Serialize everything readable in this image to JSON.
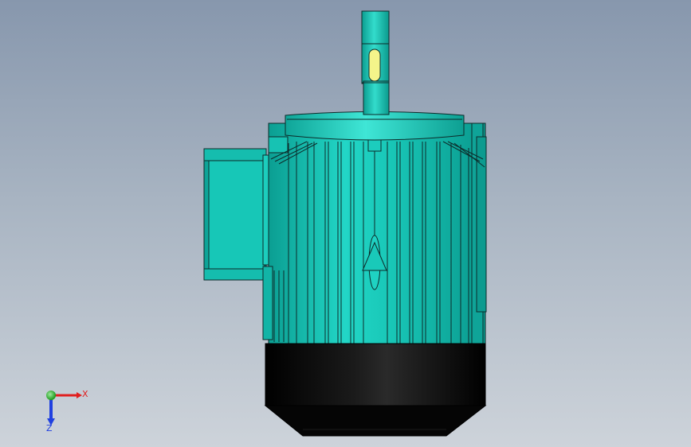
{
  "colors": {
    "body": "#18c4b4",
    "body_light": "#3ee0d0",
    "body_dark": "#0a8c80",
    "outline": "#0d2b2a",
    "fan_cover": "#000000",
    "key_slot": "#f4f48a",
    "axis_x": "#e02020",
    "axis_y": "#20c020",
    "axis_z": "#2040e0"
  },
  "triad": {
    "x_label": "X",
    "z_label": "Z"
  }
}
